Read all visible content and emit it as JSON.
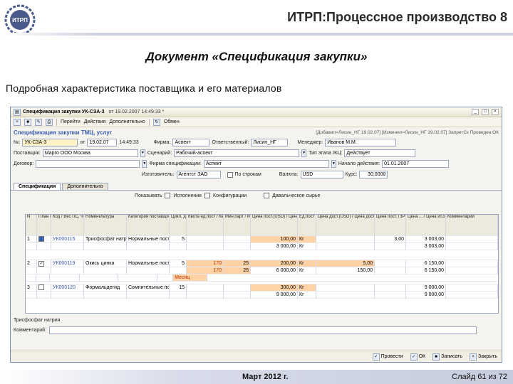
{
  "slide": {
    "logo_text": "ИТРП",
    "title": "ИТРП:Процессное производство 8",
    "doc_heading": "Документ «Спецификация закупки»",
    "subheading": "Подробная характеристика поставщика и его материалов",
    "footer_date": "Март 2012 г.",
    "footer_slide": "Слайд 61 из 72"
  },
  "window": {
    "title": "Спецификация закупки УК-СЗА-3",
    "timestamp": "от 19.02.2007 14:49:33 *",
    "toolbar": {
      "go_label": "Перейти",
      "actions_label": "Действия",
      "extra_label": "Дополнительно",
      "exchange_label": "Обмен"
    },
    "header": {
      "title": "Спецификация закупки ТМЦ, услуг",
      "info": "[Добавил=Лисин_НГ 19.02.07] [Изменил=Лисин_НГ 19.02.07] ЗапретСк Проведен:ОК"
    },
    "form": {
      "number_label": "№:",
      "number_value": "УК-СЗА-3",
      "from_label": "от",
      "date_value": "19.02.07",
      "time_value": "14:49:33",
      "firm_label": "Фирма:",
      "firm_value": "Аспект",
      "responsible_label": "Ответственный:",
      "responsible_value": "Лисин_НГ",
      "manager_label": "Менеджер:",
      "manager_value": "Иванов М.М.",
      "supplier_label": "Поставщик:",
      "supplier_value": "Марго ООО Москва",
      "scenario_label": "Сценарий:",
      "scenario_value": "Рабочий-аспект",
      "stage_label": "Тип этапа ЖЦ:",
      "stage_value": "Действует",
      "contract_label": "Договор:",
      "contract_value": "",
      "specfirm_label": "Фирма спецификации:",
      "specfirm_value": "Аспект",
      "start_label": "Начало действия:",
      "start_value": "01.01.2007",
      "maker_label": "Изготовитель:",
      "maker_value": "Агентст ЗАО",
      "by_lines_label": "По строкам",
      "currency_label": "Валюта:",
      "currency_value": "USD",
      "rate_label": "Курс:",
      "rate_value": "30,0000"
    },
    "tabs": {
      "spec_label": "Спецификация",
      "extra_label": "Дополнительно"
    },
    "grid_toolbar": {
      "show_label": "Показывать",
      "execution_label": "Исполнение",
      "configs_label": "Конфигурации",
      "tolling_label": "Давальческое сырье"
    },
    "grid": {
      "headers": [
        "N",
        "План сб",
        "Код / Вес ПС, %",
        "Номенклатура",
        "Категория поставщика",
        "Цикл, дни",
        "Квота ед.пост / Квота ед.хран / Период",
        "Мин.парт / Мин.парт хран",
        "Цена пост.(USD) / Цена (РУБ)",
        "Ед.пост / Ед.хран",
        "Цена дост.(USD) / Цена дост.сч.(РУБ)",
        "Цена пост.ТЗР (РУБ)",
        "Цена ... / Цена ит.сеч.",
        "Комментарий"
      ],
      "rows": [
        {
          "n": "1",
          "code": "УК000115",
          "item": "Трисфосфат натрия",
          "category": "Нормальные поставщики",
          "cycle": "5",
          "quota": "",
          "minbatch": "",
          "price_usd": "100,00",
          "price_rub": "3 000,00",
          "unit1": "Кг",
          "unit2": "Кг",
          "dost_usd": "",
          "dost_rub": "",
          "tzr": "3,00",
          "total1": "3 003,00",
          "total2": "3 003,00",
          "comment": ""
        },
        {
          "n": "2",
          "code": "УК000119",
          "item": "Окись цинка",
          "category": "Нормальные поставщики",
          "cycle": "5",
          "quota": "170",
          "quota2": "170",
          "period": "Месяц",
          "minbatch": "25",
          "minbatch2": "25",
          "price_usd": "200,00",
          "price_rub": "6 000,00",
          "unit1": "Кг",
          "unit2": "Кг",
          "dost_usd": "5,00",
          "dost_rub": "150,00",
          "tzr": "",
          "total1": "6 150,00",
          "total2": "6 150,00",
          "comment": ""
        },
        {
          "n": "3",
          "code": "УК000120",
          "item": "Формальдегид",
          "category": "Сомнительные поставщики",
          "cycle": "15",
          "quota": "",
          "minbatch": "",
          "price_usd": "300,00",
          "price_rub": "9 000,00",
          "unit1": "Кг",
          "unit2": "Кг",
          "dost_usd": "",
          "dost_rub": "",
          "tzr": "",
          "total1": "9 000,00",
          "total2": "9 000,00",
          "comment": ""
        }
      ]
    },
    "footer": {
      "selected_item": "Трисфосфат натрия",
      "comment_label": "Комментарий:",
      "comment_value": ""
    },
    "buttons": {
      "post_label": "Провести",
      "ok_label": "ОК",
      "save_label": "Записать",
      "close_label": "Закрыть"
    }
  },
  "colors": {
    "highlight": "#ffd3a6",
    "link": "#3656b3",
    "accent": "#3a5fb0"
  }
}
